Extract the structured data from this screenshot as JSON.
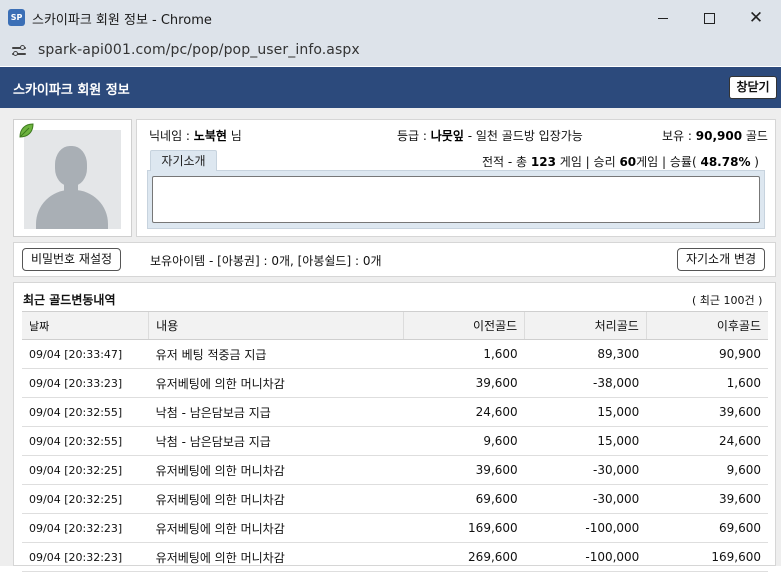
{
  "window": {
    "favicon_text": "SP",
    "title": "스카이파크 회원 정보 - Chrome",
    "url": "spark-api001.com/pc/pop/pop_user_info.aspx"
  },
  "header": {
    "title": "스카이파크 회원 정보",
    "close_label": "창닫기"
  },
  "profile": {
    "nick_label": "닉네임 : ",
    "nick_value": "노북현",
    "nick_suffix": " 님",
    "grade_label": "등급 : ",
    "grade_value": "나뭇잎",
    "grade_suffix": " - 일천 골드방 입장가능",
    "owned_label": "보유 : ",
    "owned_value": "90,900",
    "owned_suffix": " 골드",
    "record_prefix": "전적 - 총 ",
    "record_total": "123",
    "record_mid": " 게임 | 승리 ",
    "record_wins": "60",
    "record_mid2": "게임 | 승률( ",
    "record_rate": "48.78%",
    "record_end": " )",
    "intro_tab": "자기소개",
    "intro_value": ""
  },
  "items": {
    "password_button": "비밀번호 재설정",
    "text": "보유아이템 - [아봉권] : 0개, [아봉쉴드] : 0개",
    "intro_button": "자기소개 변경"
  },
  "history": {
    "title": "최근 골드변동내역",
    "count": "( 최근 100건 )",
    "columns": [
      "날짜",
      "내용",
      "이전골드",
      "처리골드",
      "이후골드"
    ],
    "rows": [
      [
        "09/04 [20:33:47]",
        "유저 베팅 적중금 지급",
        "1,600",
        "89,300",
        "90,900"
      ],
      [
        "09/04 [20:33:23]",
        "유저베팅에 의한 머니차감",
        "39,600",
        "-38,000",
        "1,600"
      ],
      [
        "09/04 [20:32:55]",
        "낙첨 - 남은담보금 지급",
        "24,600",
        "15,000",
        "39,600"
      ],
      [
        "09/04 [20:32:55]",
        "낙첨 - 남은담보금 지급",
        "9,600",
        "15,000",
        "24,600"
      ],
      [
        "09/04 [20:32:25]",
        "유저베팅에 의한 머니차감",
        "39,600",
        "-30,000",
        "9,600"
      ],
      [
        "09/04 [20:32:25]",
        "유저베팅에 의한 머니차감",
        "69,600",
        "-30,000",
        "39,600"
      ],
      [
        "09/04 [20:32:23]",
        "유저베팅에 의한 머니차감",
        "169,600",
        "-100,000",
        "69,600"
      ],
      [
        "09/04 [20:32:23]",
        "유저베팅에 의한 머니차감",
        "269,600",
        "-100,000",
        "169,600"
      ]
    ]
  },
  "colors": {
    "header_bg": "#2c4a7c",
    "chrome_bg": "#dde3ea",
    "tab_bg": "#dde7f0"
  },
  "icons": {
    "favicon": "sp-logo-icon",
    "site_info": "tune-icon",
    "grade": "leaf-icon",
    "avatar": "person-icon"
  }
}
